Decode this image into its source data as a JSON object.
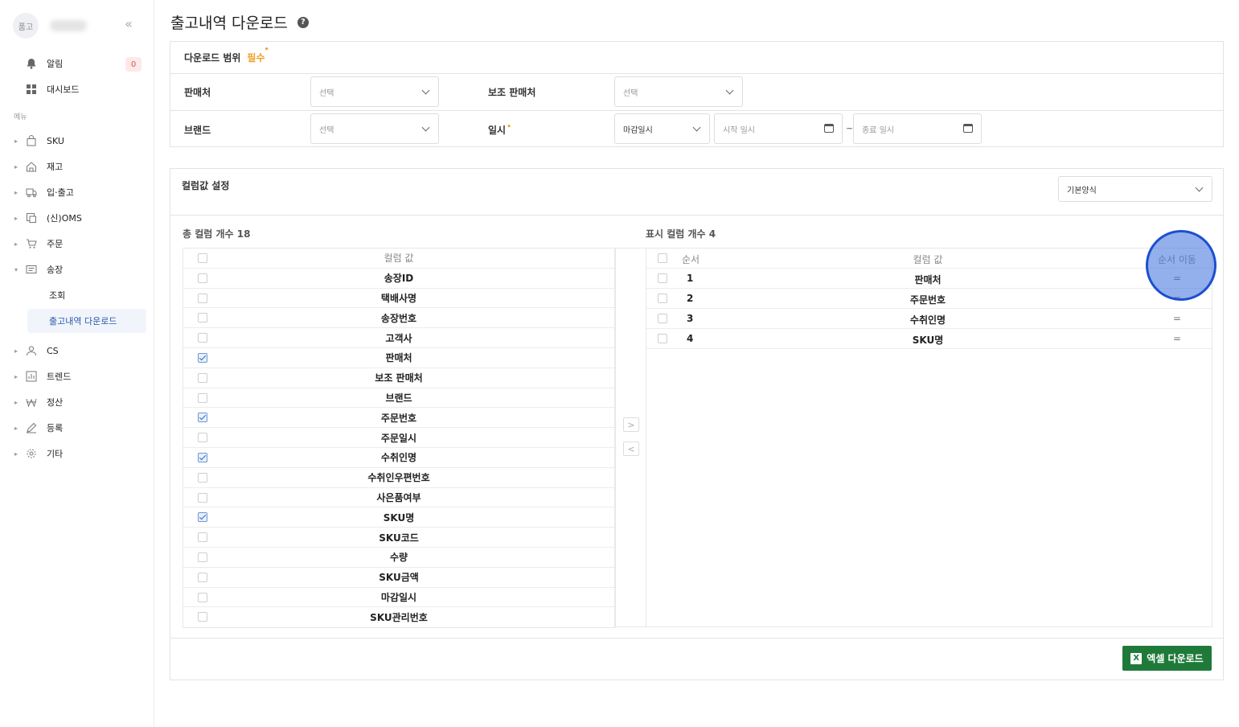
{
  "sidebar": {
    "avatar_text": "품고",
    "alert": {
      "label": "알림",
      "badge": "0"
    },
    "dashboard": {
      "label": "대시보드"
    },
    "menu_label": "메뉴",
    "items": [
      {
        "label": "SKU",
        "icon": "bag-icon"
      },
      {
        "label": "재고",
        "icon": "home-icon"
      },
      {
        "label": "입·출고",
        "icon": "truck-icon"
      },
      {
        "label": "(신)OMS",
        "icon": "oms-icon"
      },
      {
        "label": "주문",
        "icon": "cart-icon"
      },
      {
        "label": "송장",
        "icon": "invoice-icon"
      }
    ],
    "sub_items": [
      {
        "label": "조회"
      },
      {
        "label": "출고내역 다운로드"
      }
    ],
    "items_after": [
      {
        "label": "CS",
        "icon": "person-icon"
      },
      {
        "label": "트렌드",
        "icon": "chart-icon"
      },
      {
        "label": "정산",
        "icon": "won-icon"
      },
      {
        "label": "등록",
        "icon": "pencil-icon"
      },
      {
        "label": "기타",
        "icon": "gear-icon"
      }
    ]
  },
  "page": {
    "title": "출고내역 다운로드",
    "help": "?"
  },
  "range": {
    "title": "다운로드 범위",
    "required": "필수",
    "seller_label": "판매처",
    "seller_placeholder": "선택",
    "sub_seller_label": "보조 판매처",
    "sub_seller_placeholder": "선택",
    "brand_label": "브랜드",
    "brand_placeholder": "선택",
    "date_label": "일시",
    "date_type": "마감일시",
    "start_placeholder": "시작 일시",
    "end_placeholder": "종료 일시",
    "tilde": "~"
  },
  "columns": {
    "title": "컬럼값 설정",
    "format": "기본양식",
    "total_label": "총 컬럼 개수 18",
    "shown_label": "표시 컬럼 개수 4",
    "left_header": "컬럼 값",
    "left_rows": [
      {
        "name": "송장ID",
        "checked": false
      },
      {
        "name": "택배사명",
        "checked": false
      },
      {
        "name": "송장번호",
        "checked": false
      },
      {
        "name": "고객사",
        "checked": false
      },
      {
        "name": "판매처",
        "checked": true
      },
      {
        "name": "보조 판매처",
        "checked": false
      },
      {
        "name": "브랜드",
        "checked": false
      },
      {
        "name": "주문번호",
        "checked": true
      },
      {
        "name": "주문일시",
        "checked": false
      },
      {
        "name": "수취인명",
        "checked": true
      },
      {
        "name": "수취인우편번호",
        "checked": false
      },
      {
        "name": "사은품여부",
        "checked": false
      },
      {
        "name": "SKU명",
        "checked": true
      },
      {
        "name": "SKU코드",
        "checked": false
      },
      {
        "name": "수량",
        "checked": false
      },
      {
        "name": "SKU금액",
        "checked": false
      },
      {
        "name": "마감일시",
        "checked": false
      },
      {
        "name": "SKU관리번호",
        "checked": false
      }
    ],
    "move_right": ">",
    "move_left": "<",
    "right_headers": {
      "order": "순서",
      "name": "컬럼 값",
      "move": "순서 이동"
    },
    "right_rows": [
      {
        "order": "1",
        "name": "판매처",
        "move": "="
      },
      {
        "order": "2",
        "name": "주문번호",
        "move": "="
      },
      {
        "order": "3",
        "name": "수취인명",
        "move": "="
      },
      {
        "order": "4",
        "name": "SKU명",
        "move": "="
      }
    ]
  },
  "excel_button": "엑셀 다운로드",
  "excel_icon": "X"
}
